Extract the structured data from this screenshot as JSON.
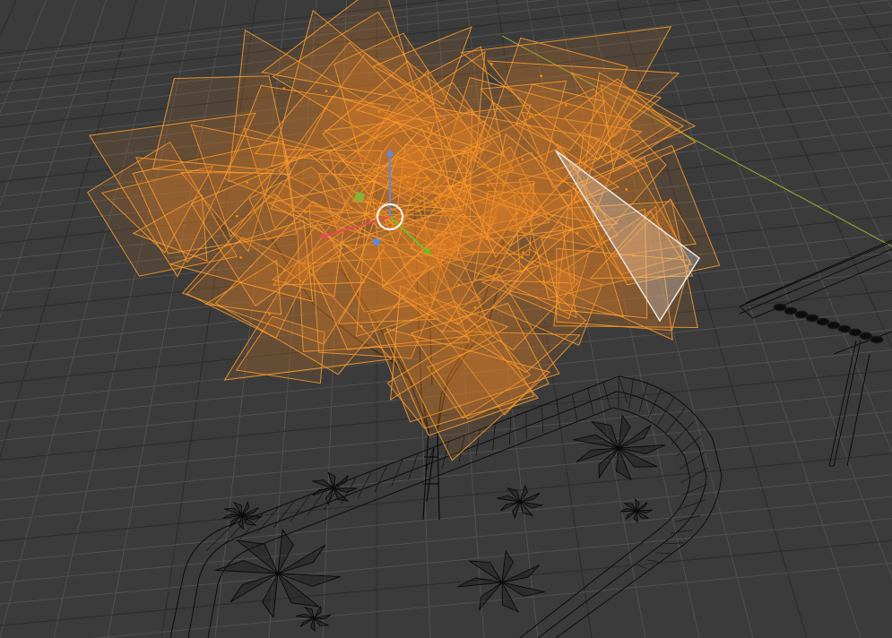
{
  "viewport": {
    "mode": "3d-viewport-wireframe",
    "background_color": "#3b3b3b",
    "grid_color": "#505050",
    "grid_major_color": "#2c2c2c",
    "axis_y_color": "#86a035",
    "selection_color": "#ff9d2c",
    "active_face_color": "#e8e8e8",
    "wire_color": "#0a0a0a"
  },
  "objects": [
    {
      "name": "tree-canopy",
      "state": "selected"
    },
    {
      "name": "tree-trunk",
      "state": "wireframe"
    },
    {
      "name": "planter-bed",
      "state": "wireframe"
    },
    {
      "name": "shrubs",
      "state": "wireframe"
    },
    {
      "name": "bench",
      "state": "wireframe"
    }
  ],
  "gizmo": {
    "type": "transform",
    "axes": [
      {
        "axis": "x",
        "color": "#e64b55"
      },
      {
        "axis": "y",
        "color": "#6cbf2a"
      },
      {
        "axis": "z",
        "color": "#5a8be6"
      }
    ],
    "pivot_color": "#ffffff"
  }
}
